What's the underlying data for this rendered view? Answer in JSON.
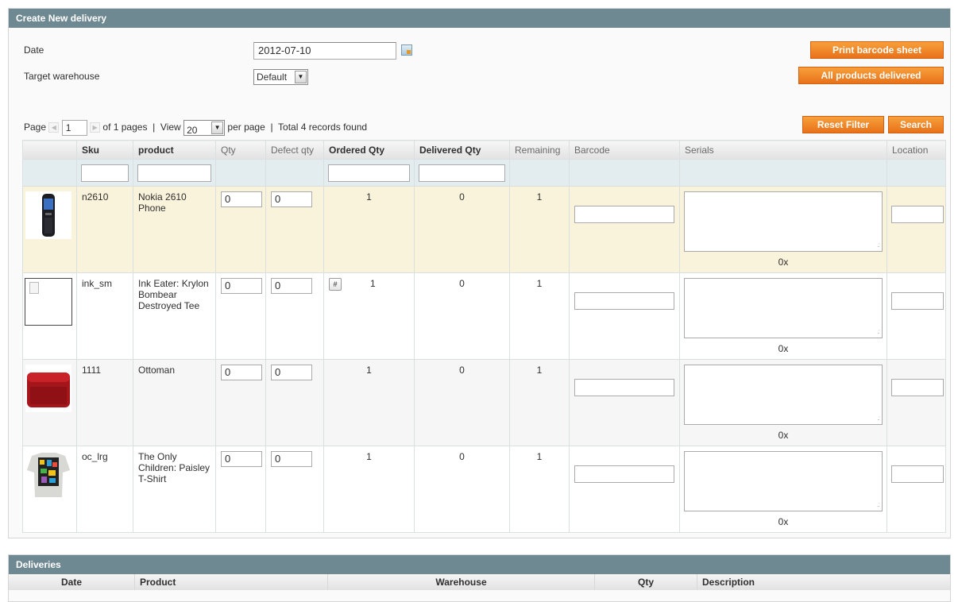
{
  "create_panel": {
    "title": "Create New delivery",
    "date_label": "Date",
    "date_value": "2012-07-10",
    "warehouse_label": "Target warehouse",
    "warehouse_value": "Default",
    "print_barcode_label": "Print barcode sheet",
    "all_delivered_label": "All products delivered"
  },
  "pager": {
    "page_label": "Page",
    "page_value": "1",
    "of_pages": "of 1 pages",
    "separator": "|",
    "view_label": "View",
    "per_page_value": "20",
    "per_page_label": "per page",
    "total": "Total 4 records found"
  },
  "grid_buttons": {
    "reset_filter": "Reset Filter",
    "search": "Search"
  },
  "columns": {
    "sku": "Sku",
    "product": "product",
    "qty": "Qty",
    "defect_qty": "Defect qty",
    "ordered_qty": "Ordered Qty",
    "delivered_qty": "Delivered Qty",
    "remaining": "Remaining",
    "barcode": "Barcode",
    "serials": "Serials",
    "location": "Location"
  },
  "rows": [
    {
      "sku": "n2610",
      "product": "Nokia 2610 Phone",
      "qty": "0",
      "defect_qty": "0",
      "ordered": "1",
      "delivered": "0",
      "remaining": "1",
      "serials_count": "0x",
      "image": "phone-image"
    },
    {
      "sku": "ink_sm",
      "product": "Ink Eater: Krylon Bombear Destroyed Tee",
      "qty": "0",
      "defect_qty": "0",
      "ordered": "1",
      "delivered": "0",
      "remaining": "1",
      "serials_count": "0x",
      "image": "missing-image",
      "hash_button": "#"
    },
    {
      "sku": "1111",
      "product": "Ottoman",
      "qty": "0",
      "defect_qty": "0",
      "ordered": "1",
      "delivered": "0",
      "remaining": "1",
      "serials_count": "0x",
      "image": "ottoman-image"
    },
    {
      "sku": "oc_lrg",
      "product": "The Only Children: Paisley T-Shirt",
      "qty": "0",
      "defect_qty": "0",
      "ordered": "1",
      "delivered": "0",
      "remaining": "1",
      "serials_count": "0x",
      "image": "tshirt-image"
    }
  ],
  "deliveries_panel": {
    "title": "Deliveries",
    "columns": {
      "date": "Date",
      "product": "Product",
      "warehouse": "Warehouse",
      "qty": "Qty",
      "description": "Description"
    }
  },
  "colors": {
    "header_bar": "#6f8992",
    "orange_button": "#ec7a1f",
    "selected_row": "#faf3db",
    "filter_row": "#e3ecef"
  }
}
